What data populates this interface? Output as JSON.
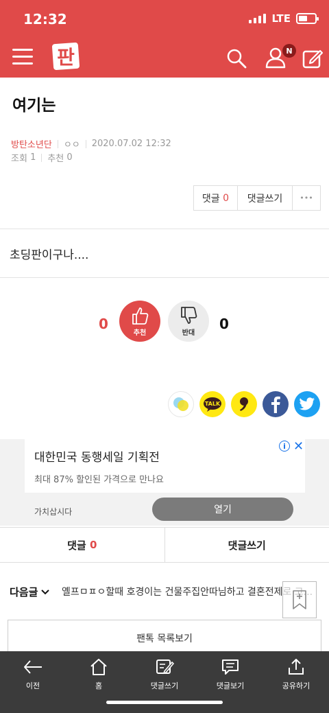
{
  "status_bar": {
    "time": "12:32",
    "network": "LTE"
  },
  "header": {
    "logo_text": "판",
    "notification_badge": "N"
  },
  "post": {
    "title": "여기는",
    "author": "방탄소년단",
    "sub_author": "ㅇㅇ",
    "datetime": "2020.07.02 12:32",
    "views_label": "조회",
    "views": "1",
    "recommend_label": "추천",
    "recommend": "0",
    "body": "초딩판이구나...."
  },
  "actions": {
    "comment_label": "댓글",
    "comment_count": "0",
    "write_comment": "댓글쓰기",
    "more": "•••"
  },
  "votes": {
    "up_count": "0",
    "up_label": "추천",
    "down_label": "반대",
    "down_count": "0"
  },
  "share": {
    "kakao_talk": "TALK"
  },
  "ad": {
    "title": "대한민국 동행세일 기획전",
    "subtitle": "최대 87% 할인된 가격으로 만나요",
    "brand": "가치삽시다",
    "cta": "열기",
    "close": "✕"
  },
  "comment_bar": {
    "comment_label": "댓글",
    "comment_count": "0",
    "write_label": "댓글쓰기"
  },
  "next_post": {
    "label": "다음글",
    "title": "옐프ㅁㅍㅇ할때 호경이는 건물주집안따님하고 결혼전제로 고..."
  },
  "list_button": "팬톡 목록보기",
  "toolbar": [
    {
      "icon": "back-arrow-icon",
      "label": "이전"
    },
    {
      "icon": "home-icon",
      "label": "홈"
    },
    {
      "icon": "write-comment-icon",
      "label": "댓글쓰기"
    },
    {
      "icon": "view-comments-icon",
      "label": "댓글보기"
    },
    {
      "icon": "share-icon",
      "label": "공유하기"
    }
  ],
  "colors": {
    "brand": "#e04a49",
    "toolbar": "#3b3b3b",
    "ad_cta": "#7b7b7b",
    "facebook": "#3b5998",
    "twitter": "#1da1f2",
    "kakao": "#ffe812"
  }
}
